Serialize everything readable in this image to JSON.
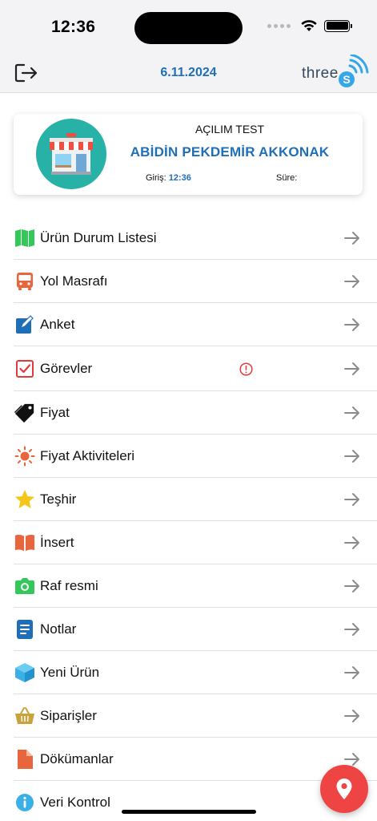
{
  "status_bar": {
    "time": "12:36"
  },
  "header": {
    "date": "6.11.2024",
    "logo_text": "three",
    "logo_badge": "S"
  },
  "store_card": {
    "subtitle": "AÇILIM TEST",
    "title": "ABİDİN PEKDEMİR AKKONAK",
    "entry_label": "Giriş:",
    "entry_time": "12:36",
    "duration_label": "Süre:"
  },
  "menu": [
    {
      "label": "Ürün Durum Listesi",
      "icon": "map-icon",
      "color": "#34c759"
    },
    {
      "label": "Yol Masrafı",
      "icon": "bus-icon",
      "color": "#e8663d"
    },
    {
      "label": "Anket",
      "icon": "edit-square-icon",
      "color": "#1f6fb8"
    },
    {
      "label": "Görevler",
      "icon": "checkbox-icon",
      "color": "#e23b3b",
      "alert": true
    },
    {
      "label": "Fiyat",
      "icon": "price-tag-icon",
      "color": "#111111"
    },
    {
      "label": "Fiyat Aktiviteleri",
      "icon": "sun-icon",
      "color": "#e8663d"
    },
    {
      "label": "Teşhir",
      "icon": "star-icon",
      "color": "#f5c518"
    },
    {
      "label": "İnsert",
      "icon": "open-book-icon",
      "color": "#e8663d"
    },
    {
      "label": "Raf resmi",
      "icon": "camera-icon",
      "color": "#34c759"
    },
    {
      "label": "Notlar",
      "icon": "notes-icon",
      "color": "#1f6fb8"
    },
    {
      "label": "Yeni Ürün",
      "icon": "cube-icon",
      "color": "#3ab0e6"
    },
    {
      "label": "Siparişler",
      "icon": "shopping-basket-icon",
      "color": "#c8a23a"
    },
    {
      "label": "Dökümanlar",
      "icon": "document-icon",
      "color": "#e8663d"
    },
    {
      "label": "Veri Kontrol",
      "icon": "info-icon",
      "color": "#3ab0e6"
    }
  ],
  "colors": {
    "accent": "#1f6fb8",
    "fab": "#ef4444",
    "card_avatar": "#28b1a6"
  }
}
